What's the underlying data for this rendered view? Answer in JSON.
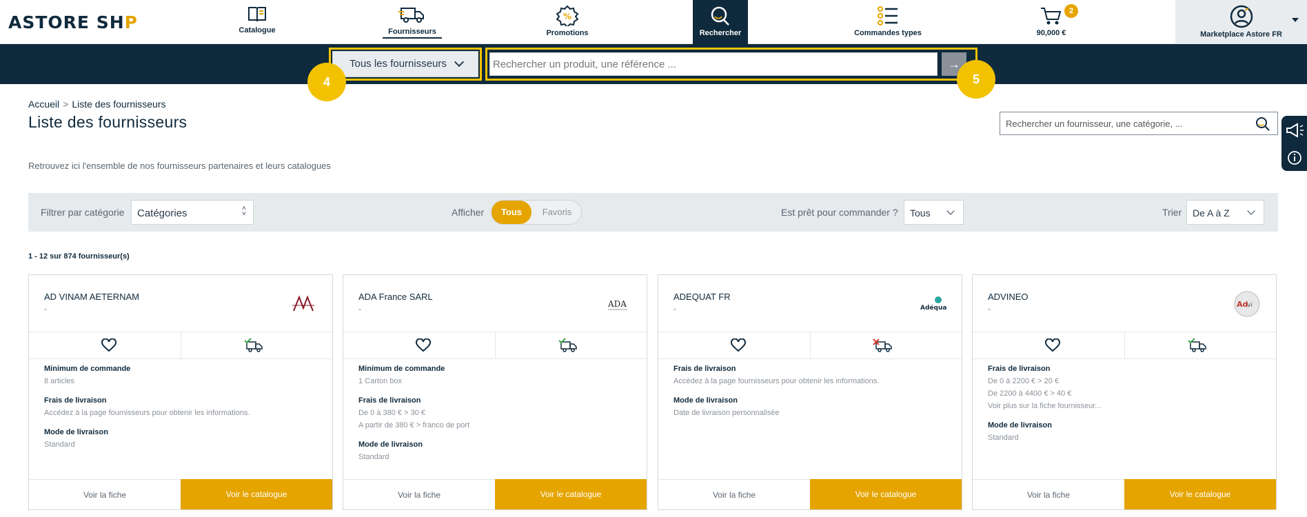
{
  "header": {
    "logo_text_a": "ASTORE SH",
    "logo_text_b": "P",
    "nav": [
      {
        "label": "Catalogue"
      },
      {
        "label": "Fournisseurs"
      },
      {
        "label": "Promotions"
      },
      {
        "label": "Rechercher"
      },
      {
        "label": "Commandes types"
      },
      {
        "label": "90,000 €"
      }
    ],
    "cart_count": "2",
    "account_label": "Marketplace Astore FR"
  },
  "search": {
    "supplier_select": "Tous les fournisseurs",
    "placeholder": "Rechercher un produit, une référence ...",
    "go": "→",
    "step_a": "4",
    "step_b": "5"
  },
  "breadcrumb": {
    "home": "Accueil",
    "sep": ">",
    "current": "Liste des fournisseurs"
  },
  "page_title": "Liste des fournisseurs",
  "supplier_search_placeholder": "Rechercher un fournisseur, une catégorie, ...",
  "intro": "Retrouvez ici l'ensemble de nos fournisseurs partenaires et leurs catalogues",
  "filters": {
    "category_label": "Filtrer par catégorie",
    "category_value": "Catégories",
    "show_label": "Afficher",
    "show_all": "Tous",
    "show_favs": "Favoris",
    "ready_label": "Est prêt pour commander ?",
    "ready_value": "Tous",
    "sort_label": "Trier",
    "sort_value": "De A à Z"
  },
  "results_count": "1 - 12 sur 874 fournisseur(s)",
  "cards": [
    {
      "name": "AD VINAM AETERNAM",
      "dash": "-",
      "info": [
        {
          "h": "Minimum de commande",
          "v": [
            "8 articles"
          ]
        },
        {
          "h": "Frais de livraison",
          "v": [
            "Accédez à la page fournisseurs pour obtenir les informations."
          ]
        },
        {
          "h": "Mode de livraison",
          "v": [
            "Standard"
          ]
        }
      ],
      "fiche": "Voir la fiche",
      "catalogue": "Voir le catalogue"
    },
    {
      "name": "ADA France SARL",
      "dash": "-",
      "info": [
        {
          "h": "Minimum de commande",
          "v": [
            "1 Carton box"
          ]
        },
        {
          "h": "Frais de livraison",
          "v": [
            "De 0 à 380 € > 30 €",
            "A partir de 380 € > franco de port"
          ]
        },
        {
          "h": "Mode de livraison",
          "v": [
            "Standard"
          ]
        }
      ],
      "fiche": "Voir la fiche",
      "catalogue": "Voir le catalogue"
    },
    {
      "name": "ADEQUAT FR",
      "dash": "-",
      "info": [
        {
          "h": "Frais de livraison",
          "v": [
            "Accédez à la page fournisseurs pour obtenir les informations."
          ]
        },
        {
          "h": "Mode de livraison",
          "v": [
            "Date de livraison personnalisée"
          ]
        }
      ],
      "fiche": "Voir la fiche",
      "catalogue": "Voir le catalogue"
    },
    {
      "name": "ADVINEO",
      "dash": "-",
      "info": [
        {
          "h": "Frais de livraison",
          "v": [
            "De 0 à 2200 € > 20 €",
            "De 2200 à 4400 € > 40 €",
            "Voir plus sur la fiche fournisseur..."
          ]
        },
        {
          "h": "Mode de livraison",
          "v": [
            "Standard"
          ]
        }
      ],
      "fiche": "Voir la fiche",
      "catalogue": "Voir le catalogue"
    }
  ],
  "colors": {
    "navy": "#0f2a3d",
    "accent": "#e5a400",
    "highlight": "#f2c200"
  }
}
